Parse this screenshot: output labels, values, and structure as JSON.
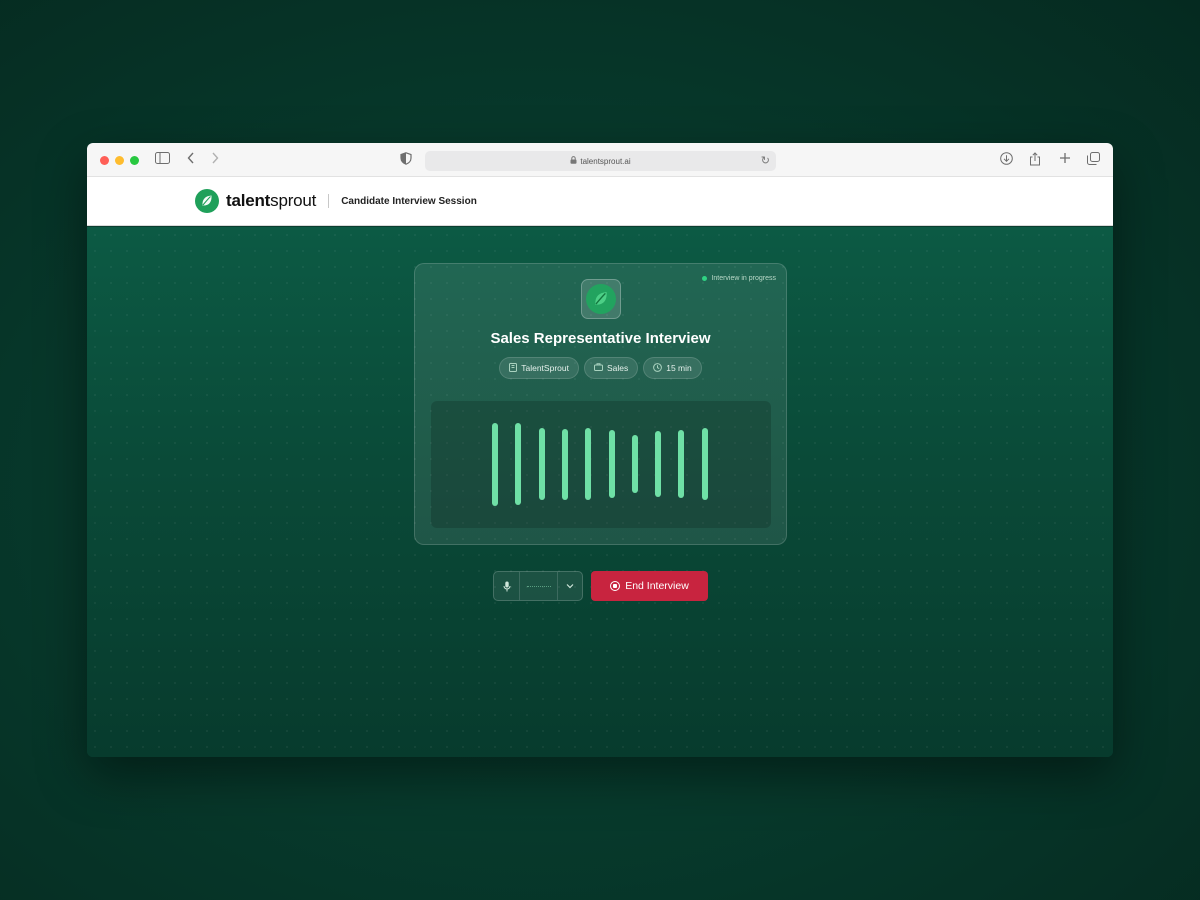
{
  "browser": {
    "url": "talentsprout.ai",
    "traffic_light_colors": [
      "#ff5f57",
      "#febc2e",
      "#28c840"
    ]
  },
  "header": {
    "brand_bold": "talent",
    "brand_light": "sprout",
    "section_title": "Candidate Interview Session",
    "brand_color": "#1fa05a"
  },
  "interview": {
    "status": "Interview in progress",
    "title": "Sales Representative Interview",
    "chips": [
      {
        "icon": "building-icon",
        "label": "TalentSprout"
      },
      {
        "icon": "briefcase-icon",
        "label": "Sales"
      },
      {
        "icon": "clock-icon",
        "label": "15 min"
      }
    ],
    "audio_levels": [
      0.92,
      0.91,
      0.8,
      0.79,
      0.8,
      0.75,
      0.64,
      0.73,
      0.75,
      0.8
    ],
    "bar_color": "#6fe0a6"
  },
  "controls": {
    "end_label": "End Interview",
    "end_color": "#c8243f"
  }
}
